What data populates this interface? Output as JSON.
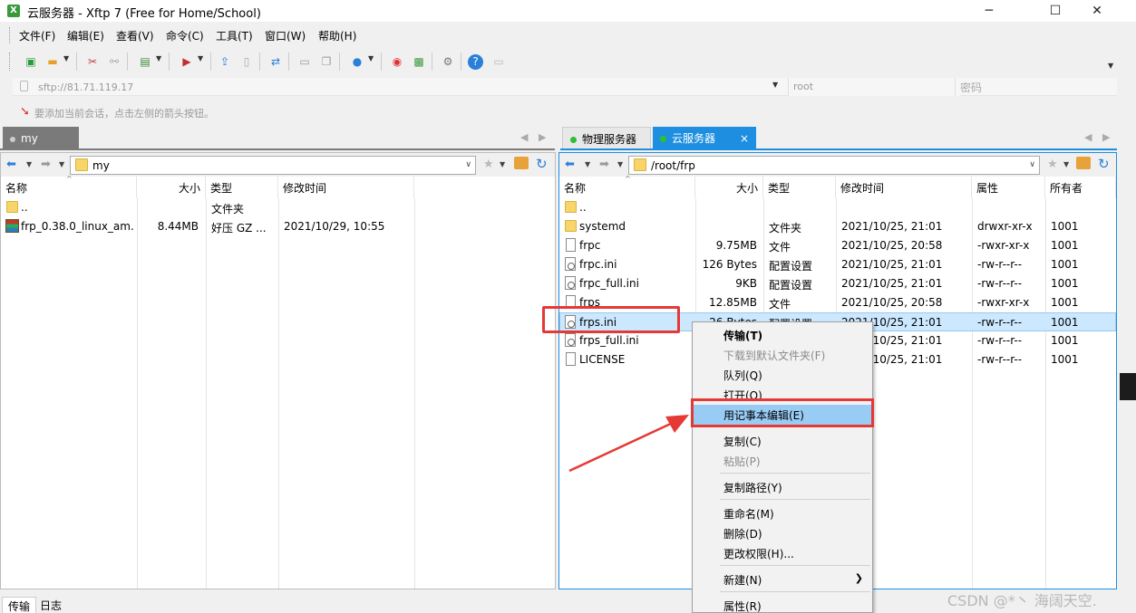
{
  "window": {
    "title": "云服务器 - Xftp 7 (Free for Home/School)",
    "app_icon_glyph": "X",
    "minimize": "─",
    "maximize": "☐",
    "close": "✕"
  },
  "menu": [
    "文件(F)",
    "编辑(E)",
    "查看(V)",
    "命令(C)",
    "工具(T)",
    "窗口(W)",
    "帮助(H)"
  ],
  "address": {
    "url": "sftp://81.71.119.17",
    "username": "root",
    "password_placeholder": "密码"
  },
  "hint": "要添加当前会话，点击左侧的箭头按钮。",
  "left_pane": {
    "tab_label": "my",
    "path": "my",
    "columns": [
      "名称",
      "大小",
      "类型",
      "修改时间"
    ],
    "rows": [
      {
        "name": "..",
        "size": "",
        "type": "文件夹",
        "modified": "",
        "icon": "folder"
      },
      {
        "name": "frp_0.38.0_linux_am...",
        "size": "8.44MB",
        "type": "好压 GZ ...",
        "modified": "2021/10/29, 10:55",
        "icon": "archive"
      }
    ]
  },
  "right_pane": {
    "tabs": [
      {
        "label": "物理服务器",
        "active": false
      },
      {
        "label": "云服务器",
        "active": true,
        "close": "×"
      }
    ],
    "path": "/root/frp",
    "columns": [
      "名称",
      "大小",
      "类型",
      "修改时间",
      "属性",
      "所有者"
    ],
    "rows": [
      {
        "name": "..",
        "size": "",
        "type": "",
        "modified": "",
        "attr": "",
        "owner": "",
        "icon": "folder"
      },
      {
        "name": "systemd",
        "size": "",
        "type": "文件夹",
        "modified": "2021/10/25, 21:01",
        "attr": "drwxr-xr-x",
        "owner": "1001",
        "icon": "folder"
      },
      {
        "name": "frpc",
        "size": "9.75MB",
        "type": "文件",
        "modified": "2021/10/25, 20:58",
        "attr": "-rwxr-xr-x",
        "owner": "1001",
        "icon": "file"
      },
      {
        "name": "frpc.ini",
        "size": "126 Bytes",
        "type": "配置设置",
        "modified": "2021/10/25, 21:01",
        "attr": "-rw-r--r--",
        "owner": "1001",
        "icon": "config"
      },
      {
        "name": "frpc_full.ini",
        "size": "9KB",
        "type": "配置设置",
        "modified": "2021/10/25, 21:01",
        "attr": "-rw-r--r--",
        "owner": "1001",
        "icon": "config"
      },
      {
        "name": "frps",
        "size": "12.85MB",
        "type": "文件",
        "modified": "2021/10/25, 20:58",
        "attr": "-rwxr-xr-x",
        "owner": "1001",
        "icon": "file"
      },
      {
        "name": "frps.ini",
        "size": "26 Bytes",
        "type": "配置设置",
        "modified": "2021/10/25, 21:01",
        "attr": "-rw-r--r--",
        "owner": "1001",
        "icon": "config",
        "selected": true
      },
      {
        "name": "frps_full.ini",
        "size": "",
        "type": "",
        "modified": "2021/10/25, 21:01",
        "attr": "-rw-r--r--",
        "owner": "1001",
        "icon": "config"
      },
      {
        "name": "LICENSE",
        "size": "",
        "type": "",
        "modified": "2021/10/25, 21:01",
        "attr": "-rw-r--r--",
        "owner": "1001",
        "icon": "file"
      }
    ]
  },
  "context_menu": [
    {
      "label": "传输(T)",
      "bold": true
    },
    {
      "label": "下载到默认文件夹(F)",
      "disabled": true
    },
    {
      "label": "队列(Q)"
    },
    {
      "label": "打开(O)"
    },
    {
      "label": "用记事本编辑(E)",
      "highlighted": true
    },
    {
      "label": "复制(C)"
    },
    {
      "label": "粘贴(P)",
      "disabled": true
    },
    {
      "label": "复制路径(Y)"
    },
    {
      "label": "重命名(M)"
    },
    {
      "label": "删除(D)"
    },
    {
      "label": "更改权限(H)..."
    },
    {
      "label": "新建(N)",
      "submenu": true
    },
    {
      "label": "属性(R)"
    }
  ],
  "bottom_tabs": [
    "传输",
    "日志"
  ],
  "watermark": "CSDN @*丶 海阔天空.",
  "colors": {
    "accent": "#1e8fe0",
    "highlight_red": "#e53935",
    "selection": "#cce8ff",
    "menu_highlight": "#99ccf5"
  }
}
